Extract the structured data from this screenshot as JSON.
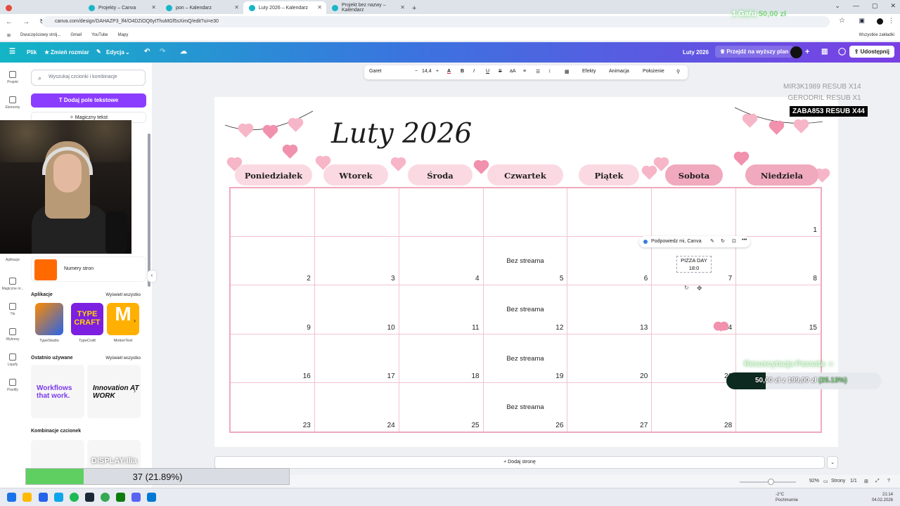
{
  "browser": {
    "tabs": [
      {
        "label": "Projekty – Canva",
        "color": "#19b5c8"
      },
      {
        "label": "pon – Kalendarz",
        "color": "#19b5c8"
      },
      {
        "label": "Luty 2026 – Kalendarz",
        "color": "#19b5c8",
        "active": true
      },
      {
        "label": "Projekt bez nazwy – Kalendarz",
        "color": "#19b5c8"
      }
    ],
    "url": "canva.com/design/DAHAZP3_lf4/O4DZiOQ6ytThuMGf5sXimQ/edit?ui=e30",
    "bookmarks": [
      "Dwuczęściowy strój...",
      "Gmail",
      "YouTube",
      "Mapy"
    ],
    "all_bookmarks": "Wszystkie zakładki"
  },
  "topbar": {
    "file": "Plik",
    "resize": "Zmień rozmiar",
    "edit": "Edycja",
    "design_title": "Luty 2026",
    "upgrade": "Przejdź na wyższy plan",
    "share": "Udostępnij"
  },
  "rail": [
    "Projekt",
    "Elementy",
    "Aplikacje",
    "Magiczne m...",
    "Tło",
    "Wykresy",
    "Liquify",
    "Pixelify"
  ],
  "panel": {
    "search_placeholder": "Wyszukaj czcionki i kombinacje",
    "add_text": "Dodaj pole tekstowe",
    "magic_text": "Magiczny tekst",
    "page_numbers": "Numery stron",
    "apps_title": "Aplikacje",
    "see_all": "Wyświetl wszystko",
    "apps": [
      "TypeStudio",
      "TypeCraft",
      "MotionText"
    ],
    "recent_title": "Ostatnio używane",
    "recent": [
      "Workflows that work.",
      "Innovation AT WORK"
    ],
    "combos_title": "Kombinacje czcionek"
  },
  "toolbar": {
    "font": "Garet",
    "size": "14,4",
    "effects": "Efekty",
    "animation": "Animacja",
    "position": "Położenie"
  },
  "calendar": {
    "title": "Luty 2026",
    "days": [
      "Poniedziałek",
      "Wtorek",
      "Środa",
      "Czwartek",
      "Piątek",
      "Sobota",
      "Niedziela"
    ],
    "weeks": [
      [
        "",
        "",
        "",
        "",
        "",
        "",
        "1"
      ],
      [
        "2",
        "3",
        "4",
        "5",
        "6",
        "7",
        "8"
      ],
      [
        "9",
        "10",
        "11",
        "12",
        "13",
        "14",
        "15"
      ],
      [
        "16",
        "17",
        "18",
        "19",
        "20",
        "21",
        "22"
      ],
      [
        "23",
        "24",
        "25",
        "26",
        "27",
        "28",
        ""
      ]
    ],
    "event_text": "Bez streama",
    "pizza_line1": "PIZZA DAY",
    "pizza_line2": "18:0",
    "assist_popup": "Podpowiedz mi, Canva"
  },
  "footer": {
    "add_page": "+ Dodaj stronę",
    "zoom": "92%",
    "zoom_level": 0.5,
    "pages_label": "Strony",
    "pages": "1/1"
  },
  "overlay": {
    "goal_prefix": "1 Gaŕu",
    "goal_value": "50,00 zł",
    "resub1": "MIR3K1989  RESUB X14",
    "resub2": "GERODRIL  RESUB X1",
    "zaba": "ZABA853  RESUB X44",
    "passat_title": "Resuscytacja Passata",
    "passat_progress": "50,00 zł z 199,00 zł",
    "passat_pct": "(25.13%)",
    "passat_fraction": 0.2513,
    "display_label": "DISPLAY:Ilia",
    "bottom_progress": "37 (21.89%)",
    "bottom_fraction": 0.2189
  },
  "taskbar": {
    "weather": "-2°C",
    "weather_desc": "Pochmurnie",
    "time": "21:14",
    "date": "04.02.2026"
  }
}
